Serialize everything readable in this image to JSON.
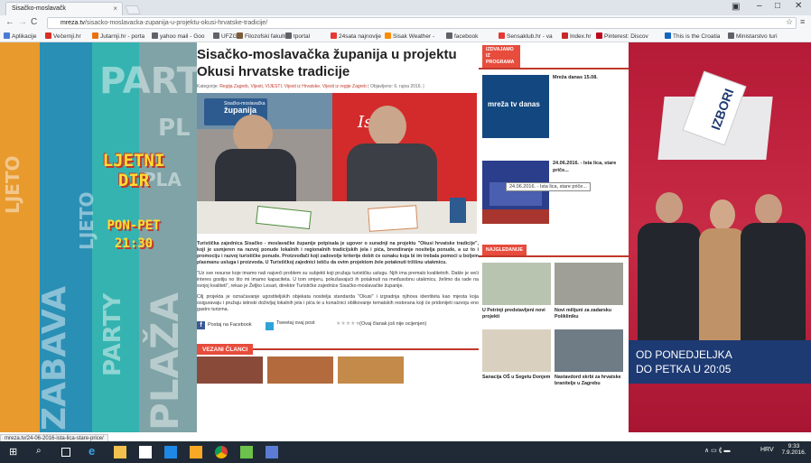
{
  "browser": {
    "tab_title": "Sisačko-moslavačk",
    "tab_close": "×",
    "url_domain": "mreza.tv",
    "url_path": "/sisacko-moslavacka-zupanija-u-projektu-okusi-hrvatske-tradicije/",
    "bookmarks": [
      {
        "label": "Aplikacije",
        "color": "#4a7bd6"
      },
      {
        "label": "Večernji.hr",
        "color": "#d93025"
      },
      {
        "label": "Jutarnji.hr - porta",
        "color": "#e8710a"
      },
      {
        "label": "yahoo mail - Goo",
        "color": "#5f6368"
      },
      {
        "label": "UFZG",
        "color": "#5f6368"
      },
      {
        "label": "Filozofski fakulte",
        "color": "#7b5b3a"
      },
      {
        "label": "tportal",
        "color": "#5f6368"
      },
      {
        "label": "24sata najnovije",
        "color": "#e53935"
      },
      {
        "label": "Sisak Weather -",
        "color": "#fb8c00"
      },
      {
        "label": "facebook",
        "color": "#5f6368"
      },
      {
        "label": "Sensaklub.hr - va",
        "color": "#e53935"
      },
      {
        "label": "Index.hr",
        "color": "#c62828"
      },
      {
        "label": "Pinterest: Discov",
        "color": "#bd081c"
      },
      {
        "label": "This is the Croatia",
        "color": "#1565c0"
      },
      {
        "label": "Ministarstvo turi",
        "color": "#5f6368"
      }
    ]
  },
  "left_ad": {
    "words": [
      "PART",
      "PL",
      "LJETO",
      "PLAŽA",
      "ZABAVA",
      "PARTY",
      "LJETO",
      "PLA"
    ],
    "show_title": "LJETNI DIR",
    "show_days": "PON-PET",
    "show_time": "21:30"
  },
  "article": {
    "title": "Sisačko-moslavačka županija u projektu Okusi hrvatske tradicije",
    "meta_label": "Kategorije:",
    "meta_categories": "Regija Zagreb, Vijesti, VIJESTI, Vijesti iz Hrvatske, Vijesti iz regije Zagreb",
    "meta_date": "| Objavljeno: 6. rujna 2016. |",
    "photo_sign_top": "Sisačko-moslavačka",
    "photo_sign_bottom": "županija",
    "photo_banner": "Istin",
    "lead": "Turistička zajednica Sisačko - moslavačke županije potpisala je ugovor o suradnji na projektu \"Okusi hrvatske tradicije\", koji je usmjeren na razvoj ponude lokalnih i regionalnih tradicijskih jela i pića, brendiranje nositelja ponude, a uz to i promociju i razvoj turističke ponude. Protzvođači koji zadovolje kriterije dobit će oznaku koja bi im trebala pomoći u boljem plasmanu usluga i proizvoda. U Turističkoj zajednici ističu da ovim projektom žele potaknuti tržišnu utakmicu.",
    "p2": "\"Uz sve resurse koje imamo naš najveći problem su subjekti koji pružaju turističku uslugu. Njih ima premalo kvalitetnih. Dakle je veći interes gostiju no što mi imamo kapaciteta. U tom smjeru, pokušavajući ih potaknuti na međusobnu utakmicu, želimo da rade na svojoj kvaliteti\", rekao je Željko Lesart, direktor Turističke zajednice Sisačko-moslavačke županije.",
    "p3": "Cilj projekta je označavanje ugostiteljskih objekata nositelja standarda \"Okusi\" i izgradnja njihova identiteta kao mjesta koja osiguravaju i pružaju istinski doživljaj lokalnih jela i pića te u konačnici oblikovanje tematskih restorana koji će pridonijeti razvoju eno gastro turizma.",
    "share_facebook": "Postaj na Facebook",
    "share_twitter": "Tweetaj ovaj post",
    "rating": "(Ovaj članak još nije ocijenjen)",
    "related_label": "VEZANI ČLANCI"
  },
  "sidebar": {
    "section1_label": "IZDVAJAMO IZ PROGRAMA",
    "item1_thumb_text": "mreža tv danas",
    "item1_caption": "Mreža danas 15.08.",
    "item2_caption": "24.06.2016. - Ista lica, stare priče...",
    "tooltip": "24.06.2016. - Ista lica, stare priče...",
    "section2_label": "NAJGLEDANIJE",
    "grid": [
      {
        "caption": "U Petrinji predstavljeni novi projekti"
      },
      {
        "caption": "Novi milijuni za zadarsku Polikliniku"
      },
      {
        "caption": "Sanacija OŠ u Segetu Donjem"
      },
      {
        "caption": "Nastavdord skrbi za hrvatske branitelje u Zagrebu"
      }
    ]
  },
  "right_ad": {
    "ballot_text": "IZBORI",
    "line1": "OD PONEDJELJKA",
    "line2": "DO PETKA U 20:05"
  },
  "status_url": "mreza.tv/24-06-2016-ista-lica-stare-price/",
  "tray": {
    "lang": "HRV",
    "time": "9:33",
    "date": "7.9.2016."
  }
}
